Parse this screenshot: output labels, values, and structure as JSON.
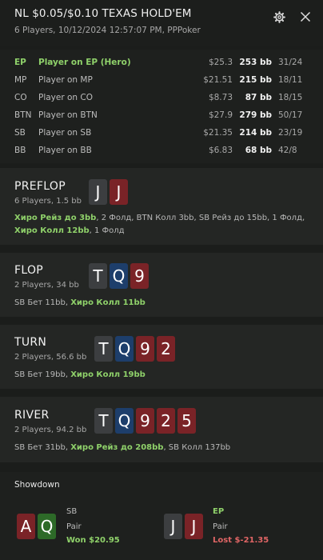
{
  "header": {
    "title": "NL $0.05/$0.10 TEXAS HOLD'EM",
    "subtitle": "6 Players, 10/12/2024 12:57:07 PM, PPPoker"
  },
  "players": [
    {
      "pos": "EP",
      "name": "Player on EP (Hero)",
      "stack": "$25.3",
      "bb": "253 bb",
      "ratio": "31/24",
      "hero": true
    },
    {
      "pos": "MP",
      "name": "Player on MP",
      "stack": "$21.51",
      "bb": "215 bb",
      "ratio": "18/11",
      "hero": false
    },
    {
      "pos": "CO",
      "name": "Player on CO",
      "stack": "$8.73",
      "bb": "87 bb",
      "ratio": "18/15",
      "hero": false
    },
    {
      "pos": "BTN",
      "name": "Player on BTN",
      "stack": "$27.9",
      "bb": "279 bb",
      "ratio": "50/17",
      "hero": false
    },
    {
      "pos": "SB",
      "name": "Player on SB",
      "stack": "$21.35",
      "bb": "214 bb",
      "ratio": "23/19",
      "hero": false
    },
    {
      "pos": "BB",
      "name": "Player on BB",
      "stack": "$6.83",
      "bb": "68 bb",
      "ratio": "42/8",
      "hero": false
    }
  ],
  "streets": {
    "preflop": {
      "name": "PREFLOP",
      "info": "6 Players, 1.5 bb",
      "cards": [
        "J",
        "J"
      ],
      "actions": [
        {
          "text": "Хиро Рейз до 3bb",
          "hero": true
        },
        {
          "text": ", 2 Фолд, BTN Колл 3bb, SB Рейз до 15bb, 1 Фолд, ",
          "hero": false
        },
        {
          "text": "Хиро Колл 12bb",
          "hero": true
        },
        {
          "text": ", 1 Фолд",
          "hero": false
        }
      ]
    },
    "flop": {
      "name": "FLOP",
      "info": "2 Players, 34 bb",
      "cards": [
        "T",
        "Q",
        "9"
      ],
      "actions": [
        {
          "text": "SB Бет 11bb, ",
          "hero": false
        },
        {
          "text": "Хиро Колл 11bb",
          "hero": true
        }
      ]
    },
    "turn": {
      "name": "TURN",
      "info": "2 Players, 56.6 bb",
      "cards": [
        "T",
        "Q",
        "9",
        "2"
      ],
      "actions": [
        {
          "text": "SB Бет 19bb, ",
          "hero": false
        },
        {
          "text": "Хиро Колл 19bb",
          "hero": true
        }
      ]
    },
    "river": {
      "name": "RIVER",
      "info": "2 Players, 94.2 bb",
      "cards": [
        "T",
        "Q",
        "9",
        "2",
        "5"
      ],
      "actions": [
        {
          "text": "SB Бет 31bb, ",
          "hero": false
        },
        {
          "text": "Хиро Рейз до 208bb",
          "hero": true
        },
        {
          "text": ", SB Колл 137bb",
          "hero": false
        }
      ]
    }
  },
  "showdown": {
    "title": "Showdown",
    "left": {
      "cards": [
        "A",
        "Q"
      ],
      "pos": "SB",
      "hand": "Pair",
      "result": "Won $20.95"
    },
    "right": {
      "cards": [
        "J",
        "J"
      ],
      "pos": "EP",
      "hand": "Pair",
      "result": "Lost $-21.35"
    }
  },
  "colors": {
    "hero": "#8fd16a",
    "card_red": "#7a2327",
    "card_gray": "#3c3e40",
    "card_blue": "#1d3e6b",
    "card_green": "#2d6a28",
    "lost": "#e06565"
  },
  "icons": {
    "settings": "gear-icon",
    "close": "close-icon"
  }
}
